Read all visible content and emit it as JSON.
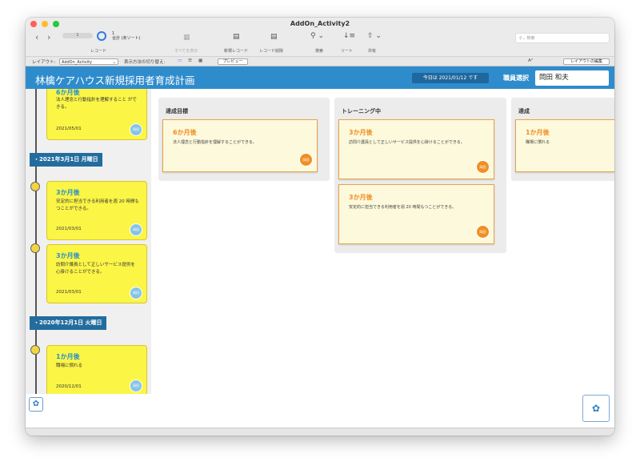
{
  "window": {
    "title": "AddOn_Activity2"
  },
  "toolbar": {
    "record_current": "1",
    "record_total": "1",
    "record_total_note": "合計 (未ソート)",
    "records_label": "レコード",
    "show_all": "すべてを表示",
    "new_record": "新規レコード",
    "delete_record": "レコード削除",
    "find": "検索",
    "sort": "ソート",
    "share": "共有",
    "search_placeholder": "検索"
  },
  "layoutbar": {
    "layout_label": "レイアウト:",
    "layout_value": "AddOn_Activity",
    "view_as_label": "表示方法の切り替え:",
    "preview_button": "プレビュー",
    "font_size_glyph": "A²",
    "edit_layout_button": "レイアウトの編集"
  },
  "header": {
    "title": "林檎ケアハウス新規採用者育成計画",
    "today_label": "今日は 2021/01/12 です",
    "staff_select_label": "職員選択",
    "staff_name": "岡田 和夫"
  },
  "timeline": {
    "top_card": {
      "title": "6か月後",
      "desc": "法人理念と行動指針を理解すること ができる。",
      "date": "2021/05/01",
      "avatar": "岡田"
    },
    "groups": [
      {
        "date_label": "・2021年3月1日 月曜日",
        "cards": [
          {
            "title": "3か月後",
            "desc": "安定的に担当できる利用者を週 20 時間もつことができる。",
            "date": "2021/03/01",
            "avatar": "岡田"
          },
          {
            "title": "3か月後",
            "desc": "訪問介護員として正しいサービス提供を心掛けることができる。",
            "date": "2021/03/01",
            "avatar": "岡田"
          }
        ]
      },
      {
        "date_label": "・2020年12月1日 火曜日",
        "cards": [
          {
            "title": "1か月後",
            "desc": "職場に慣れる",
            "date": "2020/12/01",
            "avatar": "岡田"
          }
        ]
      }
    ]
  },
  "board": {
    "columns": [
      {
        "title": "達成目標",
        "cards": [
          {
            "title": "6か月後",
            "desc": "法人理念と行動指針を理解することができる。",
            "avatar": "岡田"
          }
        ]
      },
      {
        "title": "トレーニング中",
        "cards": [
          {
            "title": "3か月後",
            "desc": "訪問介護員として正しいサービス提供を心掛けることができる。",
            "avatar": "岡田"
          },
          {
            "title": "3か月後",
            "desc": "安定的に担当できる利用者を週 20 時間もつことができる。",
            "avatar": "岡田"
          }
        ]
      },
      {
        "title": "達成",
        "cards": [
          {
            "title": "1か月後",
            "desc": "職場に慣れる",
            "avatar": "岡田"
          }
        ]
      }
    ]
  },
  "colors": {
    "header_bg": "#2f8ccc",
    "date_badge_bg": "#236d9e",
    "timeline_card_bg": "#fbf546",
    "board_card_bg": "#fdf9dc",
    "board_card_border": "#e8a34a",
    "accent_orange": "#ef8f24",
    "accent_blue": "#2a8fc8"
  },
  "icons": {
    "gear": "gear-icon",
    "back": "chevron-left-icon",
    "forward": "chevron-right-icon",
    "search": "magnifier-icon",
    "sort": "sort-icon",
    "share": "share-icon"
  }
}
